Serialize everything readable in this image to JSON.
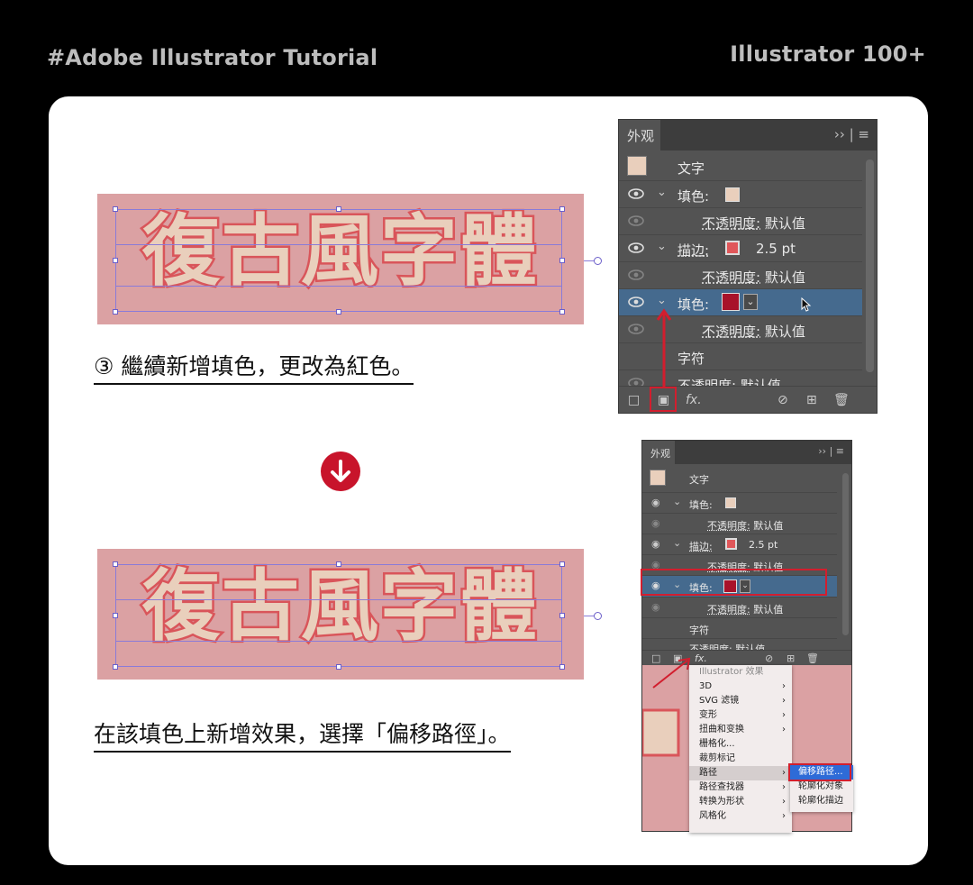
{
  "header": {
    "left_title": "#Adobe Illustrator Tutorial",
    "right_title": "Illustrator 100+"
  },
  "step1": {
    "artwork_text": "復古風字體",
    "caption": "③ 繼續新增填色，更改為紅色。"
  },
  "step2": {
    "artwork_text": "復古風字體",
    "caption": "在該填色上新增效果，選擇「偏移路徑」。"
  },
  "panel": {
    "tab_label": "外观",
    "menu_glyph": "›› | ≡",
    "object_label": "文字",
    "rows": [
      {
        "label": "填色:",
        "kind": "fill"
      },
      {
        "label": "不透明度:",
        "value": "默认值",
        "kind": "opacity"
      },
      {
        "label": "描边:",
        "value": "2.5 pt",
        "kind": "stroke"
      },
      {
        "label": "不透明度:",
        "value": "默认值",
        "kind": "opacity"
      },
      {
        "label": "填色:",
        "kind": "fill-red"
      },
      {
        "label": "不透明度:",
        "value": "默认值",
        "kind": "opacity"
      },
      {
        "label": "字符",
        "kind": "char"
      },
      {
        "label": "不透明度:",
        "value": "默认值",
        "kind": "opacity-bottom"
      }
    ],
    "fx_label": "fx."
  },
  "effects_menu": {
    "title": "Illustrator 效果",
    "items": [
      {
        "label": "3D",
        "submenu": true
      },
      {
        "label": "SVG 滤镜",
        "submenu": true
      },
      {
        "label": "变形",
        "submenu": true
      },
      {
        "label": "扭曲和变换",
        "submenu": true
      },
      {
        "label": "栅格化...",
        "submenu": false
      },
      {
        "label": "裁剪标记",
        "submenu": false
      },
      {
        "label": "路径",
        "submenu": true
      },
      {
        "label": "路径查找器",
        "submenu": true
      },
      {
        "label": "转换为形状",
        "submenu": true
      },
      {
        "label": "风格化",
        "submenu": true
      }
    ],
    "submenu": [
      "偏移路径...",
      "轮廓化对象",
      "轮廓化描边"
    ]
  },
  "colors": {
    "accent_red": "#c8142b",
    "fill_beige": "#e9cfbc",
    "fill_red": "#a8122a",
    "artwork_bg": "#dba1a3"
  }
}
